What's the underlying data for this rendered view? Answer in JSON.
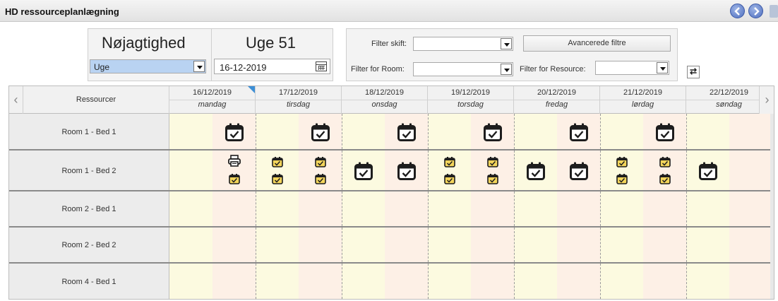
{
  "window": {
    "title": "HD ressourceplanlægning",
    "nav_prev_icon": "chevron-left-icon",
    "nav_next_icon": "chevron-right-icon"
  },
  "controls": {
    "precision_label": "Nøjagtighed",
    "precision_value": "Uge",
    "week_label": "Uge 51",
    "date_value": "16-12-2019",
    "filter_shift_label": "Filter skift:",
    "filter_shift_value": "",
    "advanced_filters_label": "Avancerede filtre",
    "filter_room_label": "Filter for Room:",
    "filter_room_value": "",
    "filter_resource_label": "Filter for Resource:",
    "filter_resource_value": ""
  },
  "grid": {
    "resource_header": "Ressourcer",
    "days": [
      {
        "date": "16/12/2019",
        "weekday": "mandag"
      },
      {
        "date": "17/12/2019",
        "weekday": "tirsdag"
      },
      {
        "date": "18/12/2019",
        "weekday": "onsdag"
      },
      {
        "date": "19/12/2019",
        "weekday": "torsdag"
      },
      {
        "date": "20/12/2019",
        "weekday": "fredag"
      },
      {
        "date": "21/12/2019",
        "weekday": "lørdag"
      },
      {
        "date": "22/12/2019",
        "weekday": "søndag"
      }
    ],
    "resources": [
      {
        "name": "Room 1 - Bed 1"
      },
      {
        "name": "Room 1 - Bed 2"
      },
      {
        "name": "Room 2 - Bed 1"
      },
      {
        "name": "Room 2 - Bed 2"
      },
      {
        "name": "Room 4 - Bed 1"
      }
    ],
    "bookings": [
      {
        "resource": 0,
        "day": 0,
        "slot": "pm",
        "kind": "single"
      },
      {
        "resource": 0,
        "day": 1,
        "slot": "pm",
        "kind": "single"
      },
      {
        "resource": 0,
        "day": 2,
        "slot": "pm",
        "kind": "single"
      },
      {
        "resource": 0,
        "day": 3,
        "slot": "pm",
        "kind": "single"
      },
      {
        "resource": 0,
        "day": 4,
        "slot": "pm",
        "kind": "single"
      },
      {
        "resource": 0,
        "day": 5,
        "slot": "pm",
        "kind": "single"
      },
      {
        "resource": 1,
        "day": 0,
        "slot": "pm",
        "kind": "print-stack"
      },
      {
        "resource": 1,
        "day": 1,
        "slot": "am",
        "kind": "double"
      },
      {
        "resource": 1,
        "day": 1,
        "slot": "pm",
        "kind": "double"
      },
      {
        "resource": 1,
        "day": 2,
        "slot": "am",
        "kind": "single"
      },
      {
        "resource": 1,
        "day": 2,
        "slot": "pm",
        "kind": "single"
      },
      {
        "resource": 1,
        "day": 3,
        "slot": "am",
        "kind": "double"
      },
      {
        "resource": 1,
        "day": 3,
        "slot": "pm",
        "kind": "double"
      },
      {
        "resource": 1,
        "day": 4,
        "slot": "am",
        "kind": "single"
      },
      {
        "resource": 1,
        "day": 4,
        "slot": "pm",
        "kind": "single"
      },
      {
        "resource": 1,
        "day": 5,
        "slot": "am",
        "kind": "double"
      },
      {
        "resource": 1,
        "day": 5,
        "slot": "pm",
        "kind": "double"
      },
      {
        "resource": 1,
        "day": 6,
        "slot": "am",
        "kind": "single"
      }
    ]
  },
  "icons": {
    "booking": "calendar-check-icon",
    "booking_small": "calendar-check-small-icon",
    "print": "printer-icon",
    "date_picker": "calendar-grid-icon",
    "refresh": "refresh-icon"
  },
  "colors": {
    "am_bg": "#fcfae0",
    "pm_bg": "#fdf0e6",
    "header_bg": "#f1f1f1",
    "precision_select_bg": "#b9d3f2",
    "nav_button": "#5b78c7",
    "today_marker": "#3d8fd6",
    "small_icon_fill": "#f3d55b"
  },
  "symbols": {
    "scroll_left": "‹",
    "scroll_right": "›",
    "refresh": "⇄"
  }
}
